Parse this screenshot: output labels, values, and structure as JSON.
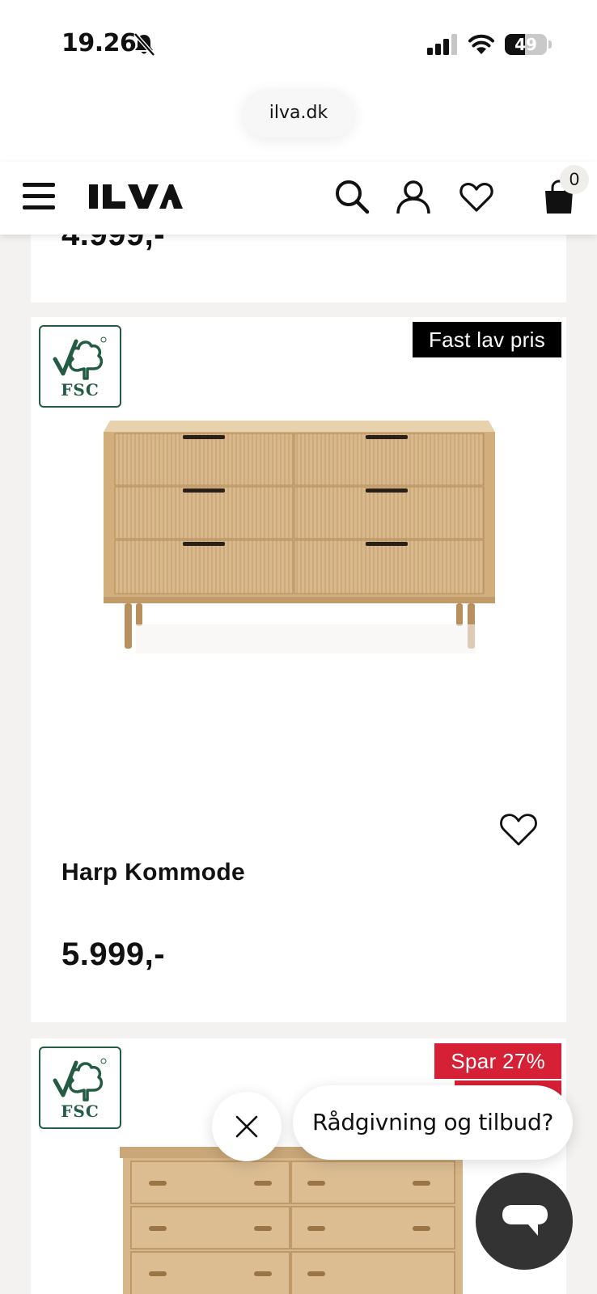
{
  "status_bar": {
    "time": "19.26",
    "battery": "49",
    "battery_level": 0.49
  },
  "browser": {
    "url": "ilva.dk"
  },
  "header": {
    "logo_text": "ILVA",
    "cart_count": "0",
    "icons": [
      "menu-icon",
      "search-icon",
      "account-icon",
      "wishlist-icon",
      "cart-icon"
    ]
  },
  "products": {
    "previous": {
      "price": "4.999,-"
    },
    "items": [
      {
        "badge": "Fast lav pris",
        "certification": "FSC",
        "name": "Harp Kommode",
        "price": "5.999,-"
      },
      {
        "badge": "Spar 27%",
        "certification": "FSC"
      }
    ]
  },
  "chat": {
    "prompt": "Rådgivning og tilbud?"
  },
  "colors": {
    "page_bg": "#f4f2f0",
    "fsc_green": "#235b43",
    "sale_red": "#d62035",
    "badge_black": "#000000",
    "chat_fab": "#333333"
  }
}
